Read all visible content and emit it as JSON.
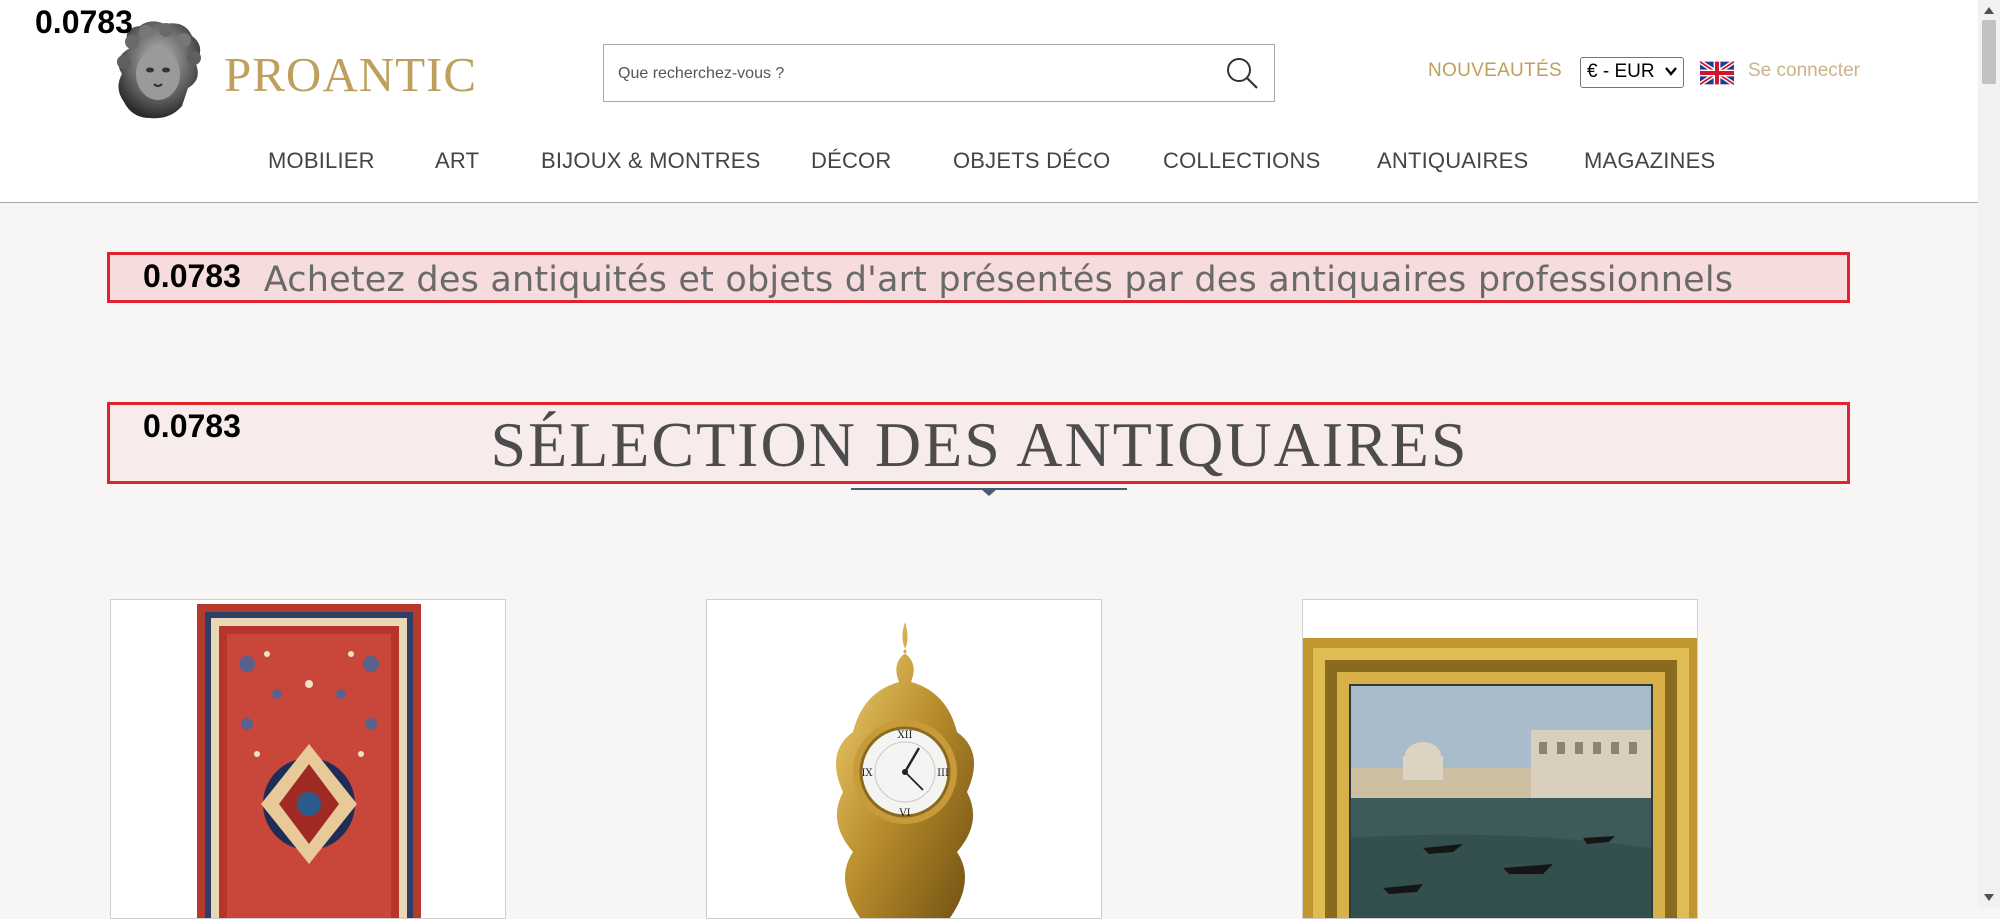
{
  "brand": {
    "name": "PROANTIC"
  },
  "search": {
    "placeholder": "Que recherchez-vous ?"
  },
  "header_links": {
    "news": "NOUVEAUTÉS",
    "currency": "€ - EUR",
    "login": "Se connecter"
  },
  "nav": [
    "MOBILIER",
    "ART",
    "BIJOUX & MONTRES",
    "DÉCOR",
    "OBJETS DÉCO",
    "COLLECTIONS",
    "ANTIQUAIRES",
    "MAGAZINES"
  ],
  "scores": [
    "0.0783",
    "0.0783",
    "0.0783"
  ],
  "hero": {
    "tagline": "Achetez des antiquités et objets d'art présentés par des antiquaires professionnels",
    "section_title": "SÉLECTION DES ANTIQUAIRES"
  },
  "colors": {
    "brand_gold": "#bf9f5c",
    "highlight_border": "#e0232e",
    "page_bg": "#f7f6f4"
  },
  "icons": {
    "search": "search-icon",
    "flag": "uk-flag-icon",
    "logo": "greek-bust-logo"
  },
  "products": [
    {
      "image": "persian-rug"
    },
    {
      "image": "gilt-bronze-clock"
    },
    {
      "image": "venice-painting-gilt-frame"
    }
  ]
}
